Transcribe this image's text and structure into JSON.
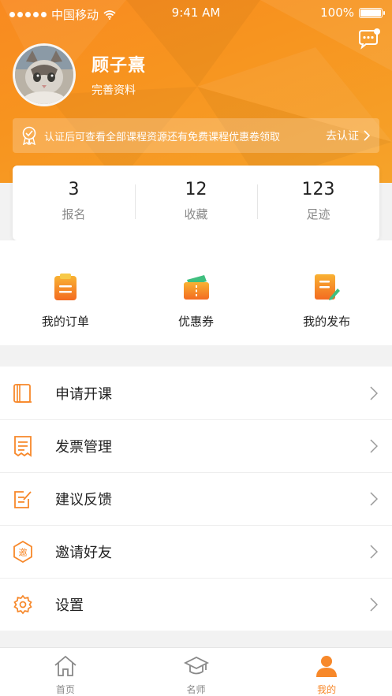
{
  "status_bar": {
    "carrier": "中国移动",
    "time": "9:41 AM",
    "battery": "100%"
  },
  "profile": {
    "name": "顾子熹",
    "subtitle": "完善资料"
  },
  "verify_banner": {
    "text": "认证后可查看全部课程资源还有免费课程优惠卷领取",
    "action": "去认证"
  },
  "stats": [
    {
      "value": "3",
      "label": "报名"
    },
    {
      "value": "12",
      "label": "收藏"
    },
    {
      "value": "123",
      "label": "足迹"
    }
  ],
  "quick_actions": [
    {
      "label": "我的订单",
      "icon": "order-icon"
    },
    {
      "label": "优惠券",
      "icon": "coupon-icon"
    },
    {
      "label": "我的发布",
      "icon": "publish-icon"
    }
  ],
  "menu": [
    {
      "label": "申请开课",
      "icon": "book-icon"
    },
    {
      "label": "发票管理",
      "icon": "receipt-icon"
    },
    {
      "label": "建议反馈",
      "icon": "edit-icon"
    },
    {
      "label": "邀请好友",
      "icon": "invite-icon"
    },
    {
      "label": "设置",
      "icon": "gear-icon"
    }
  ],
  "tabs": [
    {
      "label": "首页",
      "icon": "home-icon",
      "active": false
    },
    {
      "label": "名师",
      "icon": "graduation-cap-icon",
      "active": false
    },
    {
      "label": "我的",
      "icon": "user-icon",
      "active": true
    }
  ],
  "colors": {
    "accent": "#f7882a",
    "header_start": "#f98a20",
    "header_end": "#f6a32a"
  }
}
